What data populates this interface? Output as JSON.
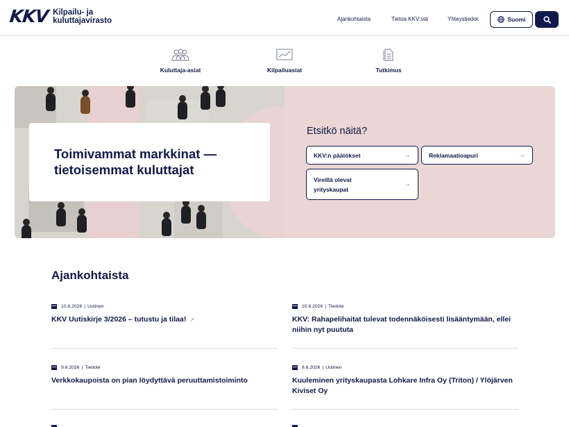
{
  "header": {
    "logo_mark": "KKV",
    "logo_line1": "Kilpailu- ja",
    "logo_line2": "kuluttajavirasto",
    "nav": [
      "Ajankohtaista",
      "Tietoa KKV:stä",
      "Yhteystiedot"
    ],
    "language": "Suomi"
  },
  "categories": [
    "Kuluttaja-asiat",
    "Kilpailuasiat",
    "Tutkimus"
  ],
  "hero": {
    "title": "Toimivammat markkinat — tietoisemmat kuluttajat",
    "question": "Etsitkö näitä?",
    "quick_links": [
      "KKV:n päätökset",
      "Reklamaatioapuri",
      "Vireillä olevat yrityskaupat"
    ],
    "arrow": "→",
    "accent_bg": "#ead6d4"
  },
  "news": {
    "heading": "Ajankohtaista",
    "items": [
      {
        "date": "10.6.2026",
        "type": "Uutinen",
        "title": "KKV Uutiskirje 3/2026 – tutustu ja tilaa!"
      },
      {
        "date": "10.6.2026",
        "type": "Tiedote",
        "title": "KKV: Rahapelihaitat tulevat todennäköisesti lisääntymään, ellei niihin nyt puututa"
      },
      {
        "date": "9.6.2026",
        "type": "Tiedote",
        "title": "Verkkokaupoista on pian löydyttävä peruuttamistoiminto"
      },
      {
        "date": "8.6.2026",
        "type": "Uutinen",
        "title": "Kuuleminen yrityskaupasta Lohkare Infra Oy (Triton) / Ylöjärven Kiviset Oy"
      }
    ],
    "external_icon": "↗"
  },
  "colors": {
    "navy": "#10194a",
    "pink": "#ead6d4",
    "divider": "#d9dce4"
  }
}
